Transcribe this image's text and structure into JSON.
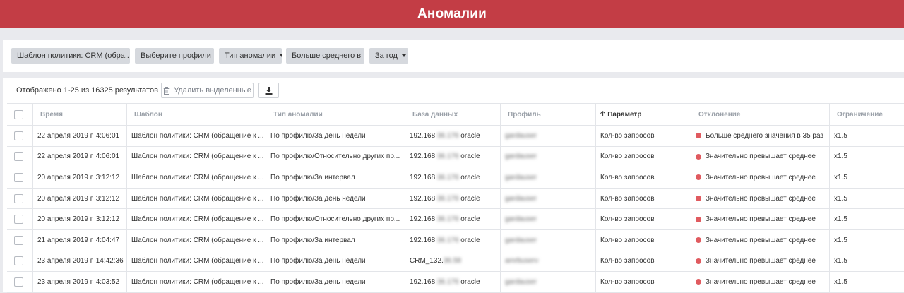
{
  "header": {
    "title": "Аномалии"
  },
  "filters": {
    "policy": "Шаблон политики: CRM (обра...",
    "profiles": "Выберите профили",
    "anomaly_type": "Тип аномалии",
    "above_avg": "Больше среднего в",
    "period": "За год"
  },
  "toolbar": {
    "results_info": "Отображено 1-25 из 16325 результатов",
    "delete_label": "Удалить выделенные"
  },
  "table": {
    "columns": {
      "time": "Время",
      "template": "Шаблон",
      "type": "Тип аномалии",
      "database": "База данных",
      "profile": "Профиль",
      "parameter": "Параметр",
      "deviation": "Отклонение",
      "limit": "Ограничение"
    },
    "rows": [
      {
        "time": "22 апреля 2019 г. 4:06:01",
        "template": "Шаблон политики: CRM (обращение к ...",
        "type": "По профилю/За день недели",
        "db_a": "192.168.",
        "db_b": "36.176",
        "db_c": " oracle",
        "profile": "gardauser",
        "parameter": "Кол-во запросов",
        "deviation": "Больше среднего значения в 35 раз",
        "limit": "x1.5"
      },
      {
        "time": "22 апреля 2019 г. 4:06:01",
        "template": "Шаблон политики: CRM (обращение к ...",
        "type": "По профилю/Относительно других пр...",
        "db_a": "192.168.",
        "db_b": "36.176",
        "db_c": " oracle",
        "profile": "gardauser",
        "parameter": "Кол-во запросов",
        "deviation": "Значительно превышает среднее",
        "limit": "x1.5"
      },
      {
        "time": "20 апреля 2019 г. 3:12:12",
        "template": "Шаблон политики: CRM (обращение к ...",
        "type": "По профилю/За интервал",
        "db_a": "192.168.",
        "db_b": "36.176",
        "db_c": " oracle",
        "profile": "gardauser",
        "parameter": "Кол-во запросов",
        "deviation": "Значительно превышает среднее",
        "limit": "x1.5"
      },
      {
        "time": "20 апреля 2019 г. 3:12:12",
        "template": "Шаблон политики: CRM (обращение к ...",
        "type": "По профилю/За день недели",
        "db_a": "192.168.",
        "db_b": "36.176",
        "db_c": " oracle",
        "profile": "gardauser",
        "parameter": "Кол-во запросов",
        "deviation": "Значительно превышает среднее",
        "limit": "x1.5"
      },
      {
        "time": "20 апреля 2019 г. 3:12:12",
        "template": "Шаблон политики: CRM (обращение к ...",
        "type": "По профилю/Относительно других пр...",
        "db_a": "192.168.",
        "db_b": "36.176",
        "db_c": " oracle",
        "profile": "gardauser",
        "parameter": "Кол-во запросов",
        "deviation": "Значительно превышает среднее",
        "limit": "x1.5"
      },
      {
        "time": "21 апреля 2019 г. 4:04:47",
        "template": "Шаблон политики: CRM (обращение к ...",
        "type": "По профилю/За интервал",
        "db_a": "192.168.",
        "db_b": "36.176",
        "db_c": " oracle",
        "profile": "gardauser",
        "parameter": "Кол-во запросов",
        "deviation": "Значительно превышает среднее",
        "limit": "x1.5"
      },
      {
        "time": "23 апреля 2019 г. 14:42:36",
        "template": "Шаблон политики: CRM (обращение к ...",
        "type": "По профилю/За день недели",
        "db_a": "CRM_132.",
        "db_b": "36.58",
        "db_c": "",
        "profile": "amrbuserv",
        "parameter": "Кол-во запросов",
        "deviation": "Значительно превышает среднее",
        "limit": "x1.5"
      },
      {
        "time": "23 апреля 2019 г. 4:03:52",
        "template": "Шаблон политики: CRM (обращение к ...",
        "type": "По профилю/За день недели",
        "db_a": "192.168.",
        "db_b": "36.176",
        "db_c": " oracle",
        "profile": "gardauser",
        "parameter": "Кол-во запросов",
        "deviation": "Значительно превышает среднее",
        "limit": "x1.5"
      }
    ]
  },
  "colors": {
    "header_bg": "#c33d45",
    "status_dot": "#e05a5f"
  }
}
